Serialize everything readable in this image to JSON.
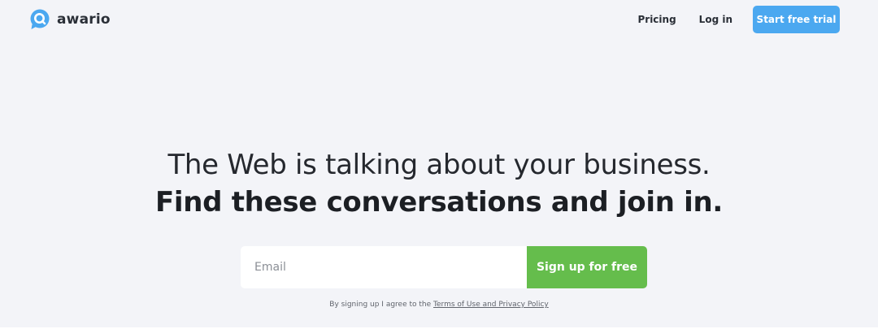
{
  "header": {
    "logo_text": "awario",
    "logo_icon": "speech-bubble-search-icon",
    "nav": {
      "pricing": "Pricing",
      "login": "Log in",
      "trial_button": "Start free trial"
    }
  },
  "hero": {
    "headline_line1": "The Web is talking about your business.",
    "headline_line2": "Find these conversations and join in."
  },
  "signup": {
    "email_placeholder": "Email",
    "email_value": "",
    "button_label": "Sign up for free"
  },
  "terms": {
    "prefix": "By signing up I agree to the ",
    "link_text": "Terms of Use and Privacy Policy"
  },
  "colors": {
    "background": "#f3f4f8",
    "accent_blue": "#4ba8f0",
    "accent_green": "#65bd4c",
    "text_dark": "#1f2228"
  }
}
